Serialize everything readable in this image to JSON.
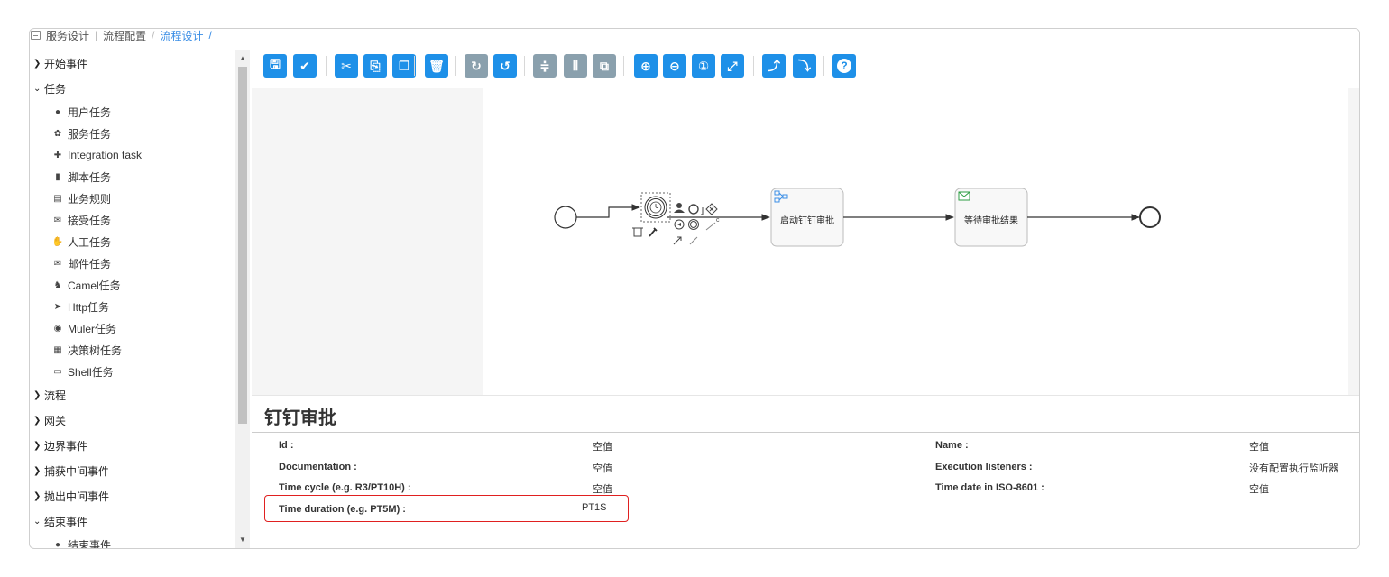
{
  "breadcrumb": {
    "items": [
      "服务设计",
      "流程配置",
      "流程设计"
    ],
    "trailing_sep": "/"
  },
  "palette": {
    "groups": [
      {
        "label": "开始事件",
        "expanded": false
      },
      {
        "label": "任务",
        "expanded": true,
        "items": [
          {
            "label": "用户任务",
            "icon": "user-icon"
          },
          {
            "label": "服务任务",
            "icon": "gear-icon"
          },
          {
            "label": "Integration task",
            "icon": "integration-icon"
          },
          {
            "label": "脚本任务",
            "icon": "script-icon"
          },
          {
            "label": "业务规则",
            "icon": "table-icon"
          },
          {
            "label": "接受任务",
            "icon": "receive-icon"
          },
          {
            "label": "人工任务",
            "icon": "hand-icon"
          },
          {
            "label": "邮件任务",
            "icon": "mail-icon"
          },
          {
            "label": "Camel任务",
            "icon": "camel-icon"
          },
          {
            "label": "Http任务",
            "icon": "send-icon"
          },
          {
            "label": "Muler任务",
            "icon": "mule-icon"
          },
          {
            "label": "决策树任务",
            "icon": "grid-icon"
          },
          {
            "label": "Shell任务",
            "icon": "terminal-icon"
          }
        ]
      },
      {
        "label": "流程",
        "expanded": false
      },
      {
        "label": "网关",
        "expanded": false
      },
      {
        "label": "边界事件",
        "expanded": false
      },
      {
        "label": "捕获中间事件",
        "expanded": false
      },
      {
        "label": "抛出中间事件",
        "expanded": false
      },
      {
        "label": "结束事件",
        "expanded": true,
        "items": [
          {
            "label": "结束事件",
            "icon": "end-event-icon"
          }
        ]
      }
    ]
  },
  "toolbar": {
    "buttons": [
      {
        "name": "save-button",
        "icon": "save-icon",
        "color": "blue"
      },
      {
        "name": "validate-button",
        "icon": "check-icon",
        "color": "blue"
      },
      {
        "name": "cut-button",
        "icon": "scissors-icon",
        "color": "blue"
      },
      {
        "name": "copy-button",
        "icon": "copy-icon",
        "color": "blue"
      },
      {
        "name": "paste-button",
        "icon": "paste-icon",
        "color": "blue"
      },
      {
        "name": "delete-button",
        "icon": "trash-icon",
        "color": "blue"
      },
      {
        "name": "redo-button",
        "icon": "redo-icon",
        "color": "gray"
      },
      {
        "name": "undo-button",
        "icon": "undo-icon",
        "color": "blue"
      },
      {
        "name": "align-horizontal-button",
        "icon": "align-horizontal-icon",
        "color": "gray"
      },
      {
        "name": "align-vertical-button",
        "icon": "align-vertical-icon",
        "color": "gray"
      },
      {
        "name": "same-size-button",
        "icon": "same-size-icon",
        "color": "gray"
      },
      {
        "name": "zoom-in-button",
        "icon": "zoom-in-icon",
        "color": "blue"
      },
      {
        "name": "zoom-out-button",
        "icon": "zoom-out-icon",
        "color": "blue"
      },
      {
        "name": "zoom-actual-button",
        "icon": "zoom-actual-icon",
        "color": "blue"
      },
      {
        "name": "zoom-fit-button",
        "icon": "zoom-fit-icon",
        "color": "blue"
      },
      {
        "name": "bend-point-add-button",
        "icon": "bendpoint-add-icon",
        "color": "blue"
      },
      {
        "name": "bend-point-remove-button",
        "icon": "bendpoint-remove-icon",
        "color": "blue"
      },
      {
        "name": "help-button",
        "icon": "help-icon",
        "color": "blue"
      }
    ]
  },
  "diagram": {
    "tasks": [
      {
        "label": "启动钉钉审批",
        "icon": "service-task-icon"
      },
      {
        "label": "等待审批结果",
        "icon": "receive-task-icon"
      }
    ],
    "colors": {
      "task_fill": "#f8f8f8",
      "task_border": "#bbbbbb",
      "flow": "#333333",
      "receive_icon": "#2e9e44",
      "service_icon": "#3a8ee6"
    }
  },
  "properties": {
    "title": "钉钉审批",
    "left": [
      {
        "label": "Id :",
        "value": "空值"
      },
      {
        "label": "Documentation :",
        "value": "空值"
      },
      {
        "label": "Time cycle (e.g. R3/PT10H) :",
        "value": "空值"
      },
      {
        "label": "Time duration (e.g. PT5M) :",
        "value": "PT1S"
      }
    ],
    "right": [
      {
        "label": "Name :",
        "value": "空值"
      },
      {
        "label": "Execution listeners :",
        "value": "没有配置执行监听器"
      },
      {
        "label": "Time date in ISO-8601 :",
        "value": "空值"
      }
    ],
    "highlight_color": "#e02020"
  },
  "icons": {
    "up-arrow": "▲",
    "down-arrow": "▼",
    "collapsed": "❯",
    "expanded": "⌄"
  }
}
